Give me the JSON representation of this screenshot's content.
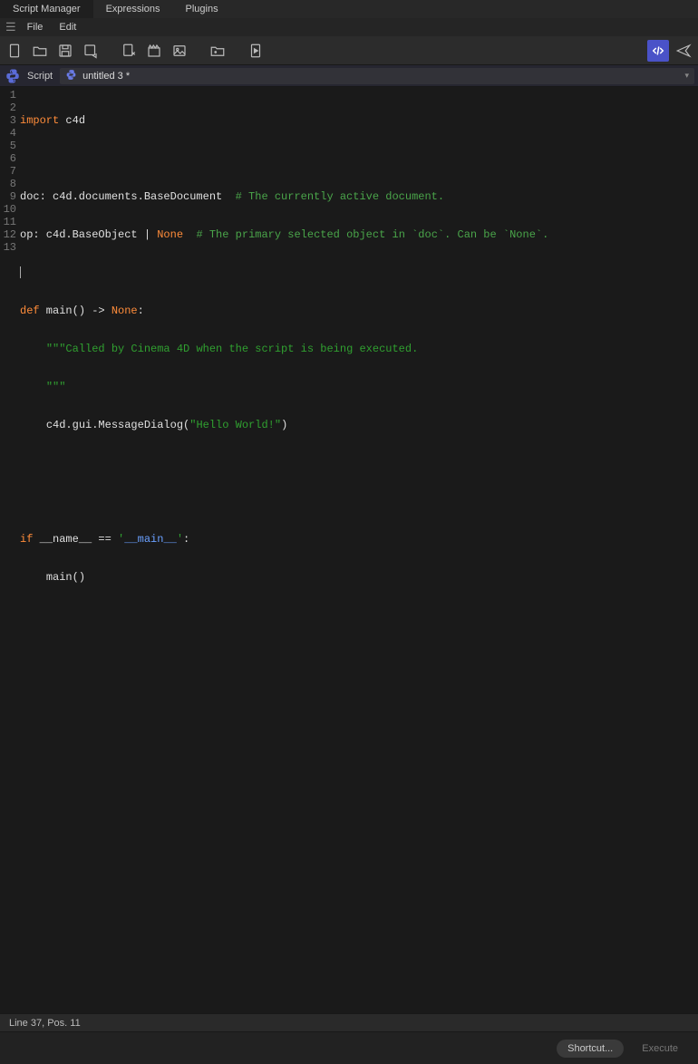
{
  "tabs": [
    {
      "label": "Script Manager",
      "active": true
    },
    {
      "label": "Expressions",
      "active": false
    },
    {
      "label": "Plugins",
      "active": false
    }
  ],
  "menus": {
    "file": "File",
    "edit": "Edit"
  },
  "toolbar_icons": {
    "new": "new-file-icon",
    "open": "open-folder-icon",
    "save": "save-icon",
    "save_as": "save-as-icon",
    "import_img": "import-image-icon",
    "clapper": "clapperboard-icon",
    "image": "image-icon",
    "load_image": "folder-image-icon",
    "play": "play-file-icon",
    "code": "code-icon",
    "send": "send-icon"
  },
  "scriptbar": {
    "label": "Script",
    "selected": "untitled 3 *"
  },
  "code": {
    "l1": {
      "import": "import",
      "mod": " c4d"
    },
    "l3": {
      "a": "doc: c4d.documents.BaseDocument  ",
      "cmt": "# The currently active document."
    },
    "l4": {
      "a": "op: c4d.BaseObject ",
      "pipe": "|",
      "none": " None",
      "sp": "  ",
      "cmt": "# The primary selected object in `doc`. Can be `None`."
    },
    "l6": {
      "def": "def",
      "sig1": " main() -> ",
      "none": "None",
      "colon": ":"
    },
    "l7": {
      "indent": "    ",
      "doc": "\"\"\"Called by Cinema 4D when the script is being executed."
    },
    "l8": {
      "indent": "    ",
      "doc": "\"\"\""
    },
    "l9": {
      "indent": "    ",
      "call1": "c4d.gui.MessageDialog(",
      "str": "\"Hello World!\"",
      "call2": ")"
    },
    "l12": {
      "if": "if",
      "sp": " ",
      "name": "__name__",
      "eq": " == ",
      "q1": "'",
      "main": "__main__",
      "q2": "'",
      "colon": ":"
    },
    "l13": {
      "indent": "    ",
      "call": "main()"
    }
  },
  "line_numbers": [
    "1",
    "2",
    "3",
    "4",
    "5",
    "6",
    "7",
    "8",
    "9",
    "10",
    "11",
    "12",
    "13"
  ],
  "status": "Line 37, Pos. 11",
  "footer": {
    "shortcut": "Shortcut...",
    "execute": "Execute"
  }
}
